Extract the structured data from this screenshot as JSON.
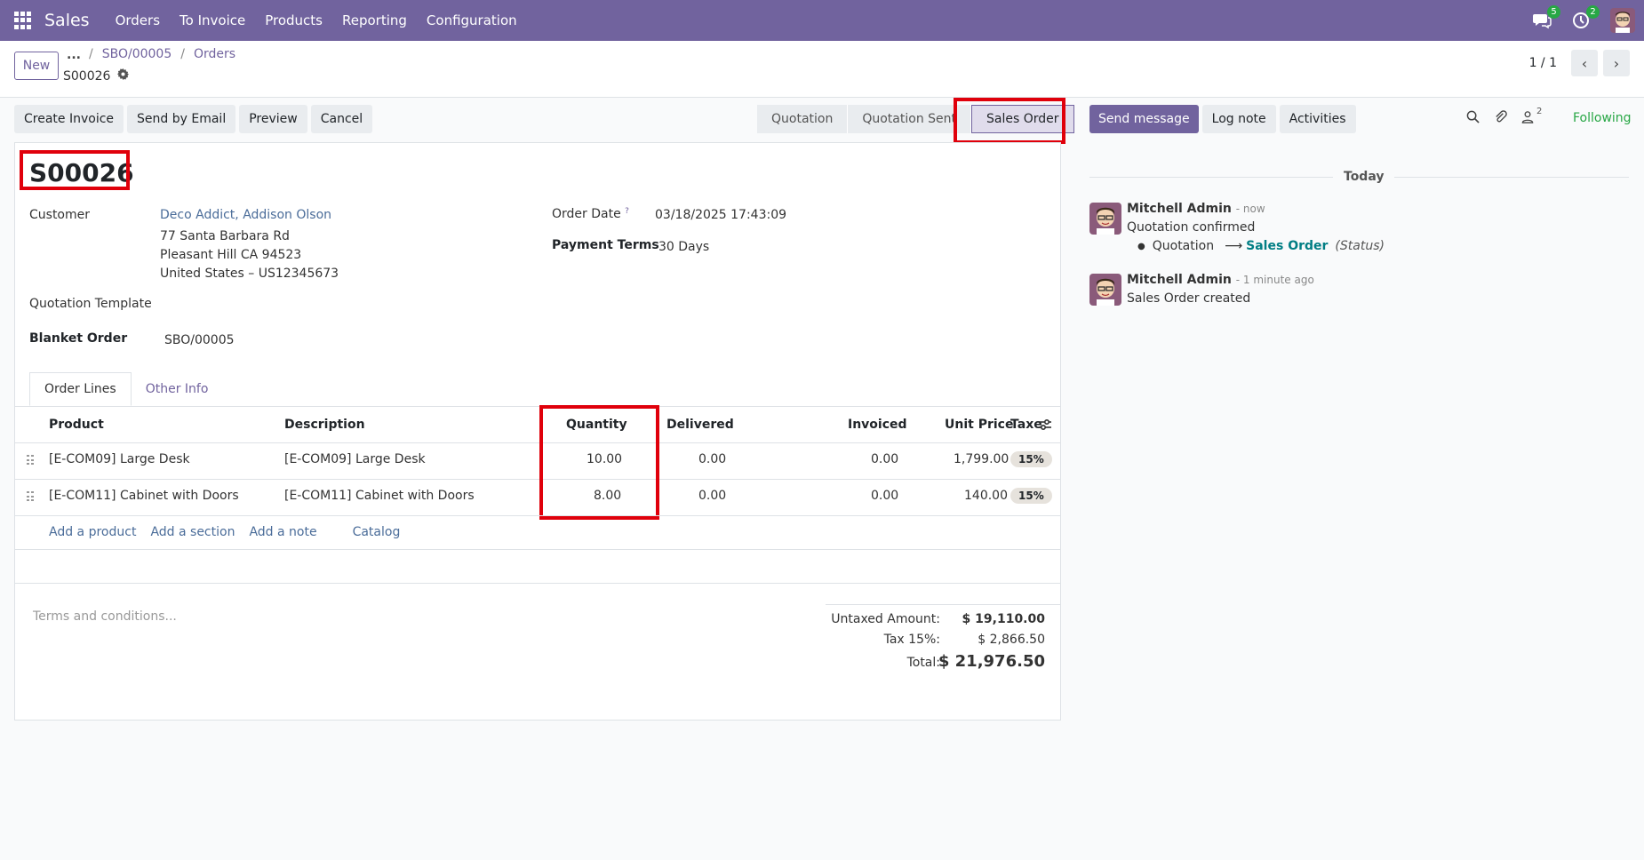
{
  "navbar": {
    "app_name": "Sales",
    "menu": [
      "Orders",
      "To Invoice",
      "Products",
      "Reporting",
      "Configuration"
    ],
    "messages_badge": "5",
    "activities_badge": "2"
  },
  "control": {
    "new_label": "New",
    "breadcrumb_dots": "...",
    "breadcrumb": [
      "SBO/00005",
      "Orders"
    ],
    "record": "S00026",
    "pager": "1 / 1"
  },
  "actions": [
    "Create Invoice",
    "Send by Email",
    "Preview",
    "Cancel"
  ],
  "stages": [
    "Quotation",
    "Quotation Sent",
    "Sales Order"
  ],
  "form": {
    "title": "S00026",
    "customer_label": "Customer",
    "customer_name": "Deco Addict, Addison Olson",
    "address1": "77 Santa Barbara Rd",
    "address2": "Pleasant Hill CA 94523",
    "address3": "United States – US12345673",
    "order_date_label": "Order Date",
    "order_date_help": "?",
    "order_date": "03/18/2025 17:43:09",
    "payment_terms_label": "Payment Terms",
    "payment_terms": "30 Days",
    "template_label": "Quotation Template",
    "blanket_label": "Blanket Order",
    "blanket": "SBO/00005"
  },
  "tabs": [
    "Order Lines",
    "Other Info"
  ],
  "table": {
    "headers": {
      "product": "Product",
      "description": "Description",
      "quantity": "Quantity",
      "delivered": "Delivered",
      "invoiced": "Invoiced",
      "unit_price": "Unit Price",
      "taxes": "Taxe"
    },
    "rows": [
      {
        "product": "[E-COM09] Large Desk",
        "description": "[E-COM09] Large Desk",
        "quantity": "10.00",
        "delivered": "0.00",
        "invoiced": "0.00",
        "unit_price": "1,799.00",
        "tax": "15%"
      },
      {
        "product": "[E-COM11] Cabinet with Doors",
        "description": "[E-COM11] Cabinet with Doors",
        "quantity": "8.00",
        "delivered": "0.00",
        "invoiced": "0.00",
        "unit_price": "140.00",
        "tax": "15%"
      }
    ],
    "add_links": [
      "Add a product",
      "Add a section",
      "Add a note",
      "Catalog"
    ]
  },
  "terms_placeholder": "Terms and conditions...",
  "totals": {
    "untaxed_label": "Untaxed Amount:",
    "untaxed": "$ 19,110.00",
    "tax_label": "Tax 15%:",
    "tax": "$ 2,866.50",
    "total_label": "Total:",
    "total": "$ 21,976.50"
  },
  "chatter": {
    "send_message": "Send message",
    "log_note": "Log note",
    "activities": "Activities",
    "followers_count": "2",
    "following": "Following",
    "today": "Today",
    "messages": [
      {
        "author": "Mitchell Admin",
        "time": "- now",
        "body": "Quotation confirmed",
        "change_from": "Quotation",
        "arrow": "⟶",
        "change_to": "Sales Order",
        "field": "(Status)"
      },
      {
        "author": "Mitchell Admin",
        "time": "- 1 minute ago",
        "body": "Sales Order created"
      }
    ]
  },
  "colors": {
    "brand": "#71639e",
    "highlight": "#e0000b",
    "following": "#28a745"
  }
}
